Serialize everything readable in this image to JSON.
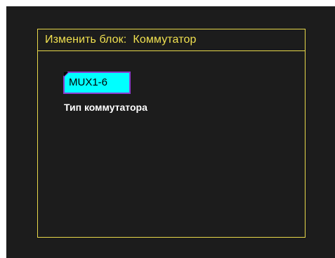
{
  "dialog": {
    "title": "Изменить блок:  Коммутатор"
  },
  "switch_block": {
    "value": "MUX1-6",
    "label": "Тип коммутатора"
  },
  "colors": {
    "background": "#1c1c1c",
    "frame": "#e8d84a",
    "title_text": "#f0e050",
    "field_fill": "#00ffff",
    "field_border": "#8a3cd0",
    "field_text": "#000000",
    "label_text": "#ffffff"
  }
}
